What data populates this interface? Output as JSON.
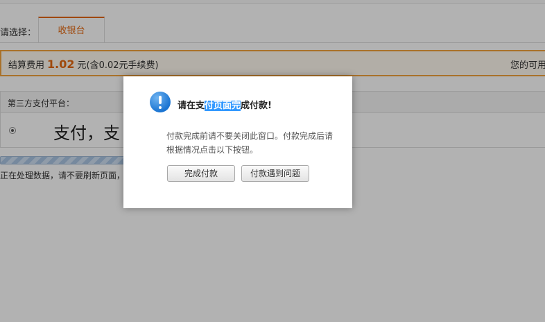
{
  "page": {
    "select_label": "请选择：",
    "tab_label": "收银台"
  },
  "fee": {
    "label": "结算费用",
    "amount": "1.02",
    "suffix": "元(含0.02元手续费)",
    "right_text": "您的可用"
  },
  "platform": {
    "title": "第三方支付平台：",
    "text": "支付，支"
  },
  "progress_text": "正在处理数据，请不要刷新页面，",
  "modal": {
    "title_pre": "请在支",
    "title_highlight": "付页面完",
    "title_post": "成付款!",
    "description": "付款完成前请不要关闭此窗口。付款完成后请根据情况点击以下按钮。",
    "done_button": "完成付款",
    "problem_button": "付款遇到问题"
  },
  "colors": {
    "accent": "#e4670f",
    "fee_border": "#f2a23c",
    "icon_blue": "#1a74d2",
    "highlight": "#3399ff"
  },
  "icons": {
    "info": "info-icon"
  }
}
